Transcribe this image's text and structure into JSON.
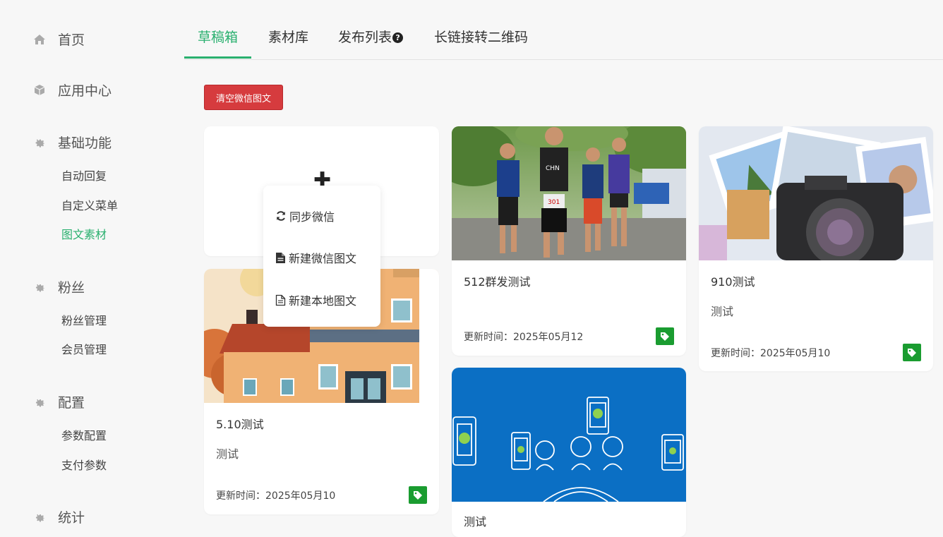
{
  "sidebar": {
    "home": "首页",
    "app_center": "应用中心",
    "basic": {
      "label": "基础功能",
      "items": [
        "自动回复",
        "自定义菜单",
        "图文素材"
      ]
    },
    "fans": {
      "label": "粉丝",
      "items": [
        "粉丝管理",
        "会员管理"
      ]
    },
    "config": {
      "label": "配置",
      "items": [
        "参数配置",
        "支付参数"
      ]
    },
    "stats": {
      "label": "统计"
    }
  },
  "tabs": [
    "草稿箱",
    "素材库",
    "发布列表",
    "长链接转二维码"
  ],
  "active_tab": "草稿箱",
  "clear_button": "清空微信图文",
  "dropdown": [
    "同步微信",
    "新建微信图文",
    "新建本地图文"
  ],
  "cards": [
    {
      "title": "5.10测试",
      "digest": "测试",
      "time": "更新时间：2025年05月10",
      "image": "house-illustration"
    },
    {
      "title": "512群发测试",
      "digest": "",
      "time": "更新时间：2025年05月12",
      "image": "runners-photo",
      "bib_text": "CHN",
      "bib_number": "301"
    },
    {
      "title": "测试",
      "digest": "",
      "time": "",
      "image": "wechat-phones-illustration"
    },
    {
      "title": "910测试",
      "digest": "测试",
      "time": "更新时间：2025年05月10",
      "image": "camera-photos"
    }
  ],
  "colors": {
    "accent": "#2ab06f",
    "danger": "#d63b3e",
    "tag": "#1a9c30"
  }
}
